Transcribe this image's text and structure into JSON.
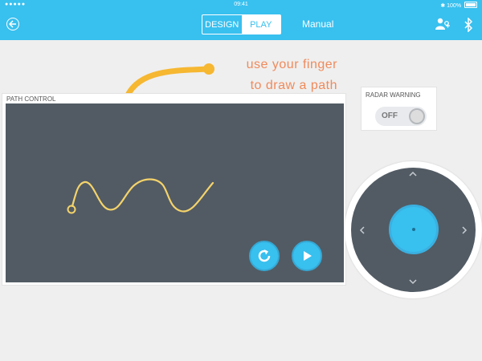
{
  "status_bar": {
    "signal": "●●●●●",
    "time": "09:41",
    "battery": "100%"
  },
  "nav": {
    "tabs": [
      {
        "label": "DESIGN",
        "selected": false
      },
      {
        "label": "PLAY",
        "selected": true
      }
    ],
    "mode": "Manual",
    "icons": [
      "back-icon",
      "users-icon",
      "bluetooth-icon"
    ]
  },
  "hint": {
    "line1": "use your finger",
    "line2": "to draw a path"
  },
  "path_control": {
    "title": "PATH CONTROL",
    "buttons": [
      "reset-icon",
      "play-icon"
    ]
  },
  "radar": {
    "title": "RADAR WARNING",
    "toggle_label": "OFF",
    "enabled": false
  },
  "joystick": {
    "directions": [
      "up",
      "down",
      "left",
      "right"
    ]
  },
  "colors": {
    "accent": "#38c0ef",
    "canvas": "#525b64",
    "hint": "#f08a5b",
    "path": "#f4d36a"
  }
}
